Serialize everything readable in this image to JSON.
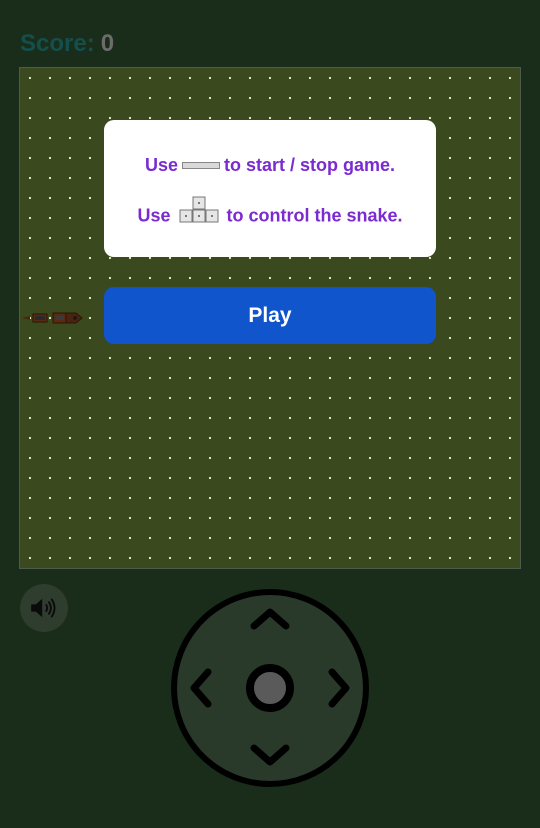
{
  "score": {
    "label": "Score:",
    "value": "0"
  },
  "help": {
    "line1_prefix": "Use",
    "line1_suffix": "to start / stop game.",
    "line2_prefix": "Use",
    "line2_suffix": "to control the snake.",
    "line1_key_icon": "spacebar-icon",
    "line2_key_icon": "arrow-keys-icon"
  },
  "play_button": {
    "label": "Play"
  },
  "sound_button": {
    "icon": "speaker-icon"
  },
  "dpad": {
    "icons": [
      "chevron-up-icon",
      "chevron-down-icon",
      "chevron-left-icon",
      "chevron-right-icon",
      "center-circle-icon"
    ]
  },
  "colors": {
    "background": "#1a2d1a",
    "board": "#3a4a1e",
    "accent_text": "#7b2bd0",
    "play_button": "#1155cc",
    "score_label": "#144f4b"
  }
}
